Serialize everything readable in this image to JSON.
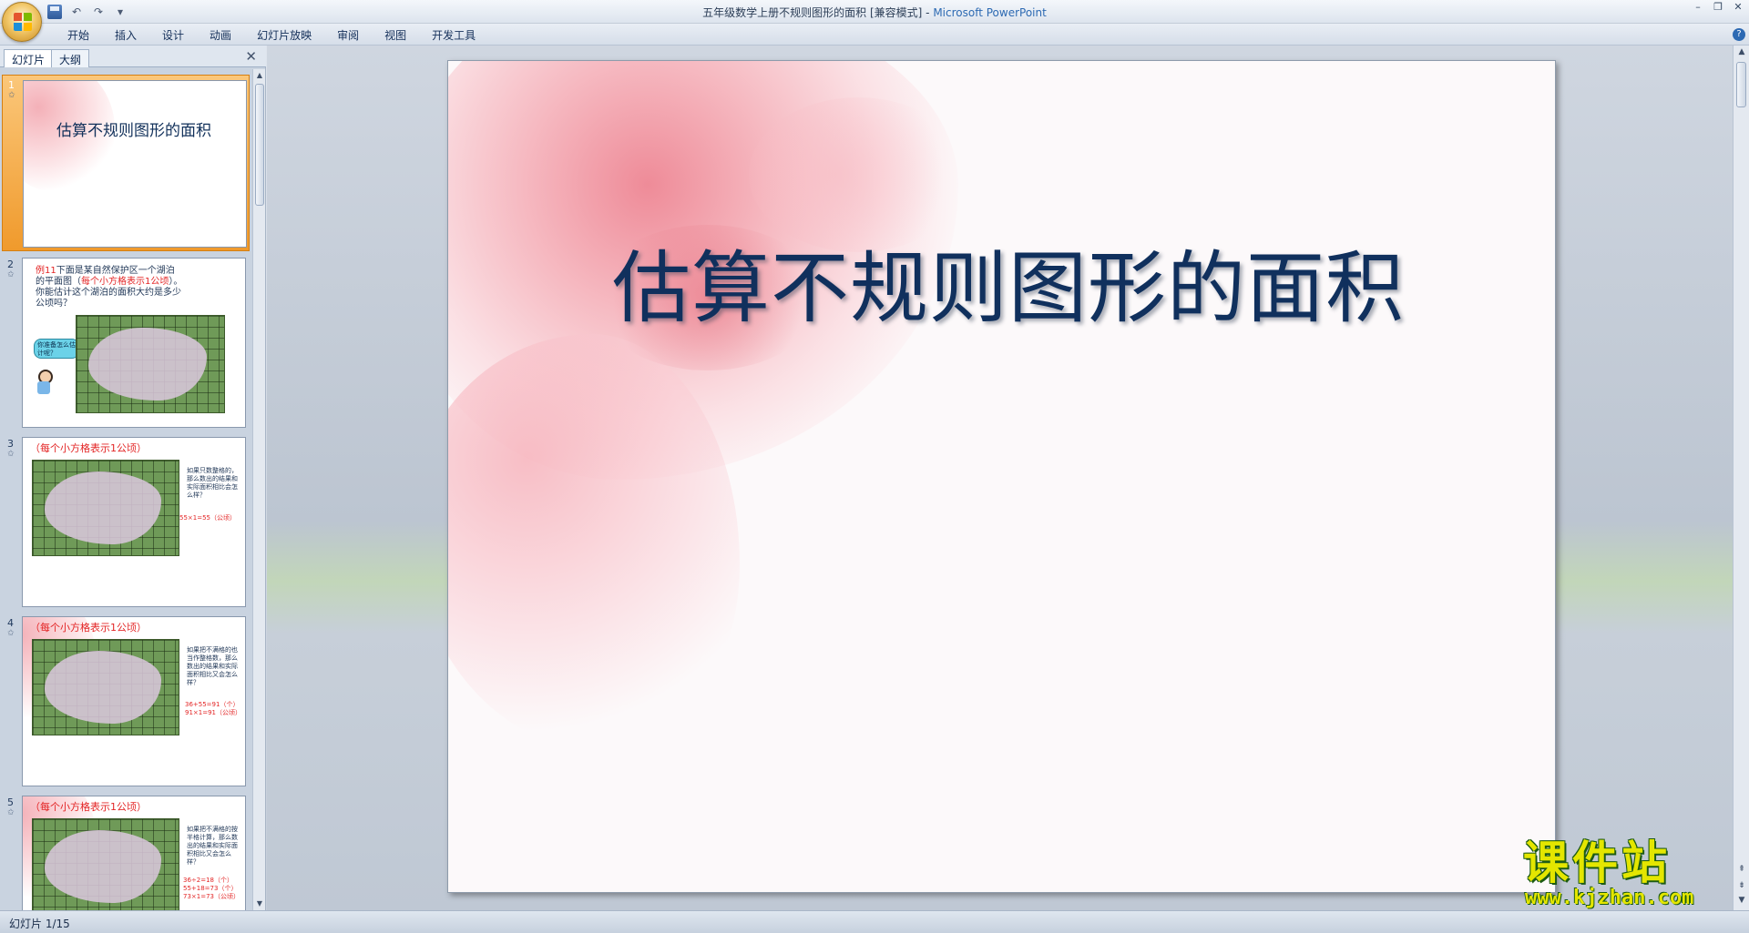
{
  "app": {
    "window_title": "五年级数学上册不规则图形的面积 [兼容模式] - ",
    "window_title_brand": "Microsoft PowerPoint"
  },
  "ribbon": {
    "tabs": [
      "开始",
      "插入",
      "设计",
      "动画",
      "幻灯片放映",
      "审阅",
      "视图",
      "开发工具"
    ]
  },
  "pane": {
    "tabs": [
      "幻灯片",
      "大纲"
    ],
    "slides": [
      {
        "num": "1",
        "title": "估算不规则图形的面积"
      },
      {
        "num": "2",
        "l1_red": "例11",
        "l1": "下面是某自然保护区一个湖泊",
        "l2": "的平面图（",
        "l2_red": "每个小方格表示1公顷",
        "l2_end": "）。",
        "l3": "你能估计这个湖泊的面积大约是多少",
        "l4": "公顷吗？",
        "bubble": "你准备怎么估计呢？"
      },
      {
        "num": "3",
        "heading": "（每个小方格表示1公顷）",
        "side": "如果只数整格的，那么数出的结果和实际面积相比会怎么样？",
        "calc": "55×1=55（公顷）"
      },
      {
        "num": "4",
        "heading": "（每个小方格表示1公顷）",
        "side": "如果把不满格的也当作整格数，那么数出的结果和实际面积相比又会怎么样？",
        "calc1": "36+55=91（个）",
        "calc2": "91×1=91（公顷）"
      },
      {
        "num": "5",
        "heading": "（每个小方格表示1公顷）",
        "side": "如果把不满格的按半格计算，那么数出的结果和实际面积相比又会怎么样？",
        "calc1": "36÷2=18（个）",
        "calc2": "55+18=73（个）",
        "calc3": "73×1=73（公顷）"
      }
    ]
  },
  "slide": {
    "title": "估算不规则图形的面积"
  },
  "status": {
    "text": "幻灯片 1/15"
  },
  "watermark": {
    "cn": "课件站",
    "url": "www.kjzhan.com"
  },
  "colors": {
    "title_navy": "#10305d",
    "selection_orange": "#f09a2c",
    "label_red": "#e32424"
  }
}
